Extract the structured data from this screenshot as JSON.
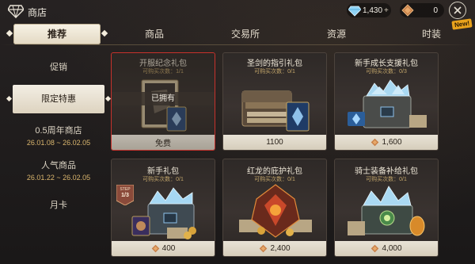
{
  "header": {
    "title": "商店",
    "gems": "1,430",
    "gems_plus": "+",
    "coins": "0",
    "new_badge": "New!"
  },
  "tabs": [
    {
      "label": "推荐",
      "active": true
    },
    {
      "label": "商品"
    },
    {
      "label": "交易所"
    },
    {
      "label": "资源"
    },
    {
      "label": "时装"
    }
  ],
  "sidebar": {
    "items": [
      {
        "label": "促销"
      },
      {
        "label": "限定特惠",
        "active": true
      },
      {
        "label": "0.5周年商店",
        "date": "26.01.08 ~ 26.02.05"
      },
      {
        "label": "人气商品",
        "date": "26.01.22 ~ 26.02.05"
      },
      {
        "label": "月卡"
      }
    ]
  },
  "cards": [
    {
      "title": "开服纪念礼包",
      "limit": "可购买次数：1/1",
      "owned": "已拥有",
      "price": "免费",
      "selected": true
    },
    {
      "title": "圣剑的指引礼包",
      "limit": "可购买次数：0/1",
      "price": "1100"
    },
    {
      "title": "新手成长支援礼包",
      "limit": "可购买次数：0/3",
      "price": "1,600"
    },
    {
      "title": "新手礼包",
      "limit": "可购买次数：0/1",
      "price": "400",
      "step": "STEP",
      "step_value": "1/3"
    },
    {
      "title": "红龙的庇护礼包",
      "limit": "可购买次数：0/1",
      "price": "2,400"
    },
    {
      "title": "骑士装备补给礼包",
      "limit": "可购买次数：0/1",
      "price": "4,000"
    }
  ],
  "colors": {
    "accent": "#c7322c",
    "gold": "#d9b56d",
    "panel": "#2e2927"
  }
}
